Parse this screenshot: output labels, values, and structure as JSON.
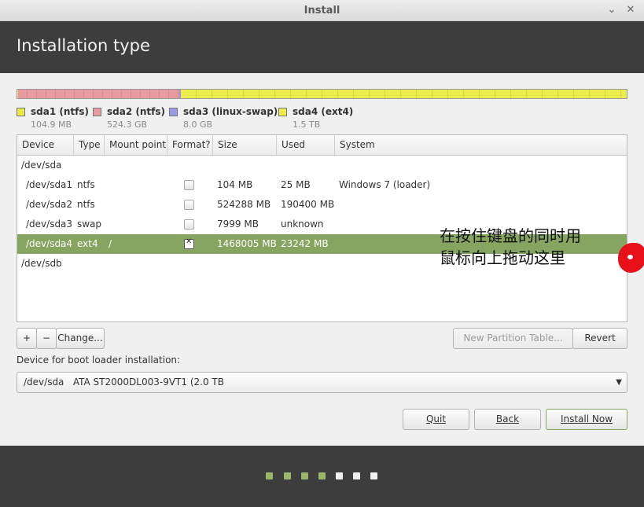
{
  "window": {
    "title": "Install",
    "min_icon": "minimize-icon",
    "close_icon": "close-icon"
  },
  "header": {
    "title": "Installation type"
  },
  "colors": {
    "ntfs1": "#e9e94a",
    "ntfs2": "#e79ba0",
    "swap": "#9a9ae6",
    "ext4": "#ecec4d",
    "selected_row": "#86a560",
    "header_bg": "#3d3d3d"
  },
  "legend": [
    {
      "name": "sda1 (ntfs)",
      "size": "104.9 MB"
    },
    {
      "name": "sda2 (ntfs)",
      "size": "524.3 GB"
    },
    {
      "name": "sda3 (linux-swap)",
      "size": "8.0 GB"
    },
    {
      "name": "sda4 (ext4)",
      "size": "1.5 TB"
    }
  ],
  "table": {
    "columns": [
      "Device",
      "Type",
      "Mount point",
      "Format?",
      "Size",
      "Used",
      "System"
    ],
    "rows": [
      {
        "device": "/dev/sda"
      },
      {
        "device": "/dev/sda1",
        "type": "ntfs",
        "mount": "",
        "format": false,
        "size": "104 MB",
        "used": "25 MB",
        "system": "Windows 7 (loader)"
      },
      {
        "device": "/dev/sda2",
        "type": "ntfs",
        "mount": "",
        "format": false,
        "size": "524288 MB",
        "used": "190400 MB",
        "system": ""
      },
      {
        "device": "/dev/sda3",
        "type": "swap",
        "mount": "",
        "format": false,
        "size": "7999 MB",
        "used": "unknown",
        "system": ""
      },
      {
        "device": "/dev/sda4",
        "type": "ext4",
        "mount": "/",
        "format": true,
        "size": "1468005 MB",
        "used": "23242 MB",
        "system": ""
      },
      {
        "device": "/dev/sdb"
      }
    ]
  },
  "annotation": {
    "line1": "在按住键盘的同时用",
    "line2": "鼠标向上拖动这里"
  },
  "toolbar": {
    "add": "+",
    "remove": "−",
    "change": "Change...",
    "new_table": "New Partition Table...",
    "revert": "Revert"
  },
  "bootloader": {
    "label": "Device for boot loader installation:",
    "value": "/dev/sda   ATA ST2000DL003-9VT1 (2.0 TB"
  },
  "actions": {
    "quit": "Quit",
    "back": "Back",
    "install": "Install Now"
  },
  "progress": {
    "done_steps": 4,
    "total_steps": 7
  }
}
